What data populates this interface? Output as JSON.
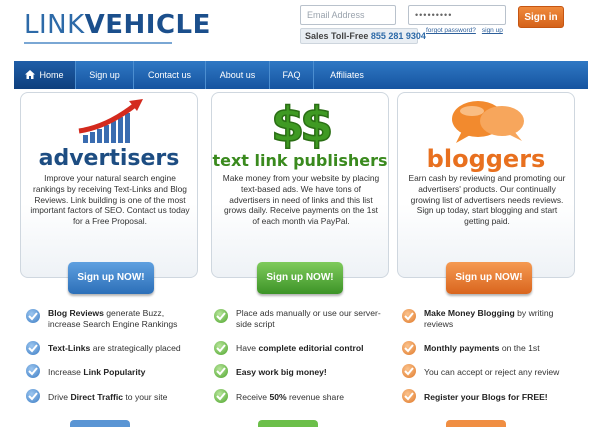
{
  "header": {
    "logo_part1": "LINK",
    "logo_part2": "VEHICLE",
    "email_placeholder": "Email Address",
    "password_value": "•••••••••",
    "signin_label": "Sign in",
    "sales_label": "Sales Toll-Free",
    "sales_number": "855 281 9304",
    "forgot_label": "forgot password?",
    "signup_link": "sign up"
  },
  "nav": {
    "items": [
      "Home",
      "Sign up",
      "Contact us",
      "About us",
      "FAQ",
      "Affiliates"
    ]
  },
  "panels": {
    "advertisers": {
      "title": "advertisers",
      "description": "Improve your natural search engine rankings by receiving Text-Links and Blog Reviews. Link building is one of the most important factors of SEO. Contact us today for a Free Proposal.",
      "button": "Sign up NOW!"
    },
    "publishers": {
      "title": "text link publishers",
      "description": "Make money from your website by placing text-based ads. We have tons of advertisers in need of links and this list grows daily. Receive payments on the 1st of each month via PayPal.",
      "button": "Sign up NOW!"
    },
    "bloggers": {
      "title": "bloggers",
      "description": "Earn cash by reviewing and promoting our advertisers' products. Our continually growing list of advertisers needs reviews. Sign up today, start blogging and start getting paid.",
      "button": "Sign up NOW!"
    }
  },
  "features": {
    "col1": [
      {
        "bold": "Blog Reviews",
        "text": " generate Buzz, increase Search Engine Rankings"
      },
      {
        "bold": "Text-Links",
        "text": " are strategically placed"
      },
      {
        "pre": "Increase ",
        "bold": "Link Popularity",
        "text": ""
      },
      {
        "pre": "Drive ",
        "bold": "Direct Traffic",
        "text": " to your site"
      }
    ],
    "col2": [
      {
        "pre": "Place ads manually or use our server-side script",
        "bold": "",
        "text": ""
      },
      {
        "pre": "Have ",
        "bold": "complete editorial control",
        "text": ""
      },
      {
        "pre": "",
        "bold": "Easy work big money!",
        "text": ""
      },
      {
        "pre": "Receive ",
        "bold": "50%",
        "text": " revenue share"
      }
    ],
    "col3": [
      {
        "pre": "",
        "bold": "Make Money Blogging",
        "text": " by writing reviews"
      },
      {
        "pre": "",
        "bold": "Monthly payments",
        "text": " on the 1st"
      },
      {
        "pre": "You can accept or reject any review",
        "bold": "",
        "text": ""
      },
      {
        "pre": "",
        "bold": "Register your Blogs for FREE!",
        "text": ""
      }
    ]
  },
  "colors": {
    "nav": "#1e63ae",
    "blue": "#2c6fb8",
    "green": "#3c9327",
    "orange": "#d9651e"
  }
}
